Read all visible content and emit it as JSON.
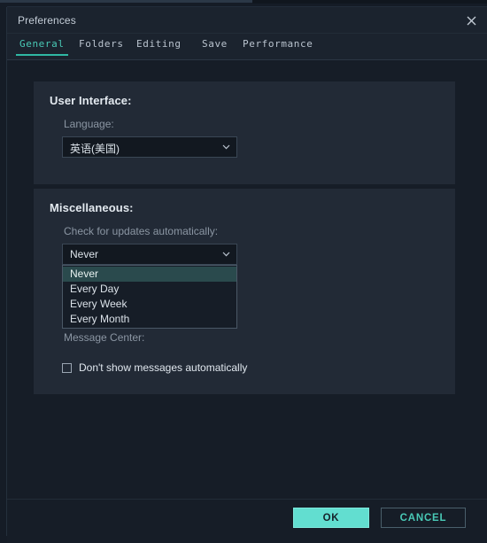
{
  "window": {
    "title": "Preferences",
    "close_icon": "close-icon"
  },
  "tabs": [
    {
      "label": "General",
      "active": true
    },
    {
      "label": "Folders",
      "active": false
    },
    {
      "label": "Editing",
      "active": false
    },
    {
      "label": "Save",
      "active": false
    },
    {
      "label": "Performance",
      "active": false
    }
  ],
  "sections": {
    "user_interface": {
      "title": "User Interface:",
      "language": {
        "label": "Language:",
        "value": "英语(美国)",
        "arrow_icon": "chevron-down-icon"
      }
    },
    "miscellaneous": {
      "title": "Miscellaneous:",
      "updates": {
        "label": "Check for updates automatically:",
        "value": "Never",
        "arrow_icon": "chevron-down-icon",
        "options": [
          "Never",
          "Every Day",
          "Every Week",
          "Every Month"
        ],
        "selected_index": 0,
        "open": true
      },
      "message_center": {
        "label": "Message Center:",
        "checkbox_label": "Don't show messages automatically",
        "checked": false
      }
    }
  },
  "footer": {
    "ok_label": "OK",
    "cancel_label": "CANCEL"
  },
  "colors": {
    "accent": "#49c9b6",
    "ok_button_bg": "#62ded0",
    "dialog_bg": "#1b232e",
    "card_bg": "#222a36",
    "content_bg": "#161d27",
    "dropdown_highlight": "#2a4a4d"
  }
}
